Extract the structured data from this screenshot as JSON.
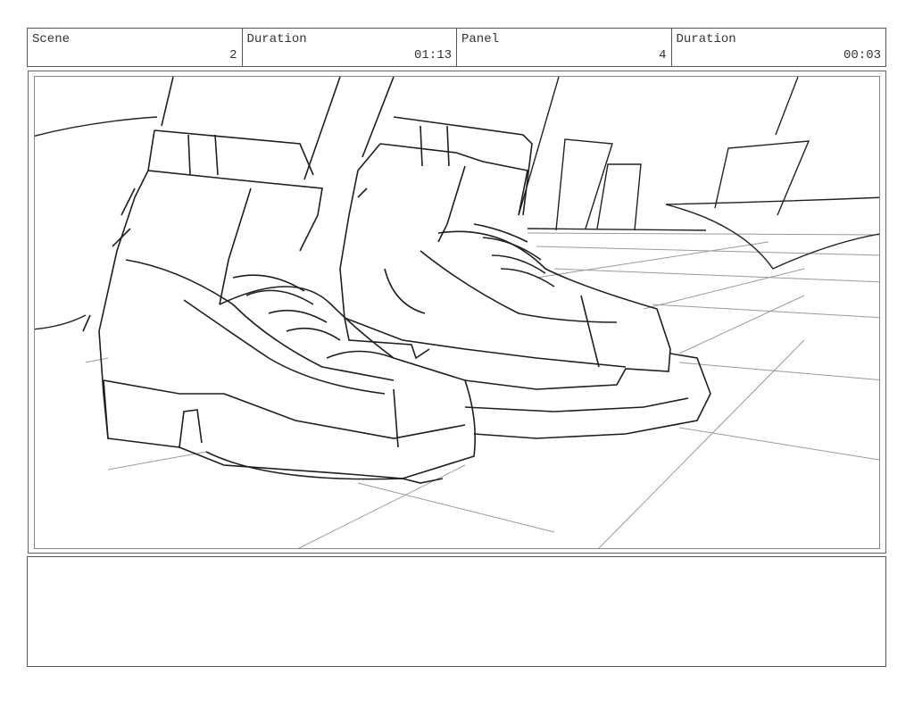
{
  "header": {
    "scene_label": "Scene",
    "scene_value": "2",
    "duration_label": "Duration",
    "duration_value": "01:13",
    "panel_label": "Panel",
    "panel_value": "4",
    "panel_duration_label": "Duration",
    "panel_duration_value": "00:03"
  },
  "notes": {
    "text": ""
  },
  "colors": {
    "border": "#555555",
    "sketch": "#222222",
    "floor_lines": "#999999"
  }
}
